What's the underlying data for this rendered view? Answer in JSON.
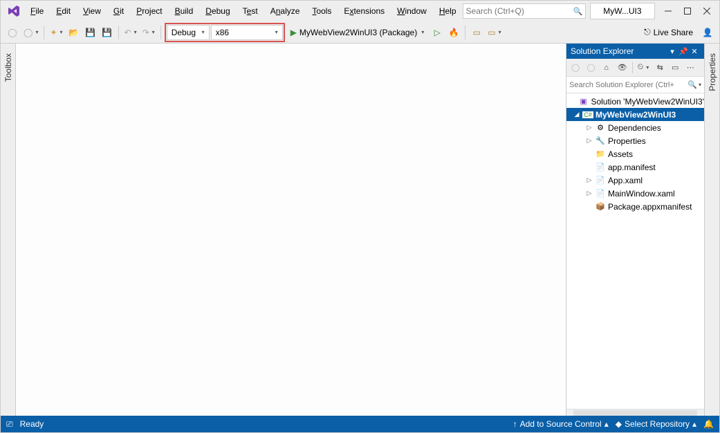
{
  "menu": [
    "File",
    "Edit",
    "View",
    "Git",
    "Project",
    "Build",
    "Debug",
    "Test",
    "Analyze",
    "Tools",
    "Extensions",
    "Window",
    "Help"
  ],
  "search": {
    "placeholder": "Search (Ctrl+Q)"
  },
  "active_doc": "MyW...UI3",
  "toolbar": {
    "config": "Debug",
    "platform": "x86",
    "start_label": "MyWebView2WinUI3 (Package)",
    "live_share": "Live Share"
  },
  "left_tab": "Toolbox",
  "right_tab": "Properties",
  "panel": {
    "title": "Solution Explorer",
    "search_placeholder": "Search Solution Explorer (Ctrl+",
    "solution": "Solution 'MyWebView2WinUI3'",
    "project": "MyWebView2WinUI3",
    "nodes": [
      "Dependencies",
      "Properties",
      "Assets",
      "app.manifest",
      "App.xaml",
      "MainWindow.xaml",
      "Package.appxmanifest"
    ]
  },
  "status": {
    "ready": "Ready",
    "source_control": "Add to Source Control",
    "repo": "Select Repository"
  }
}
